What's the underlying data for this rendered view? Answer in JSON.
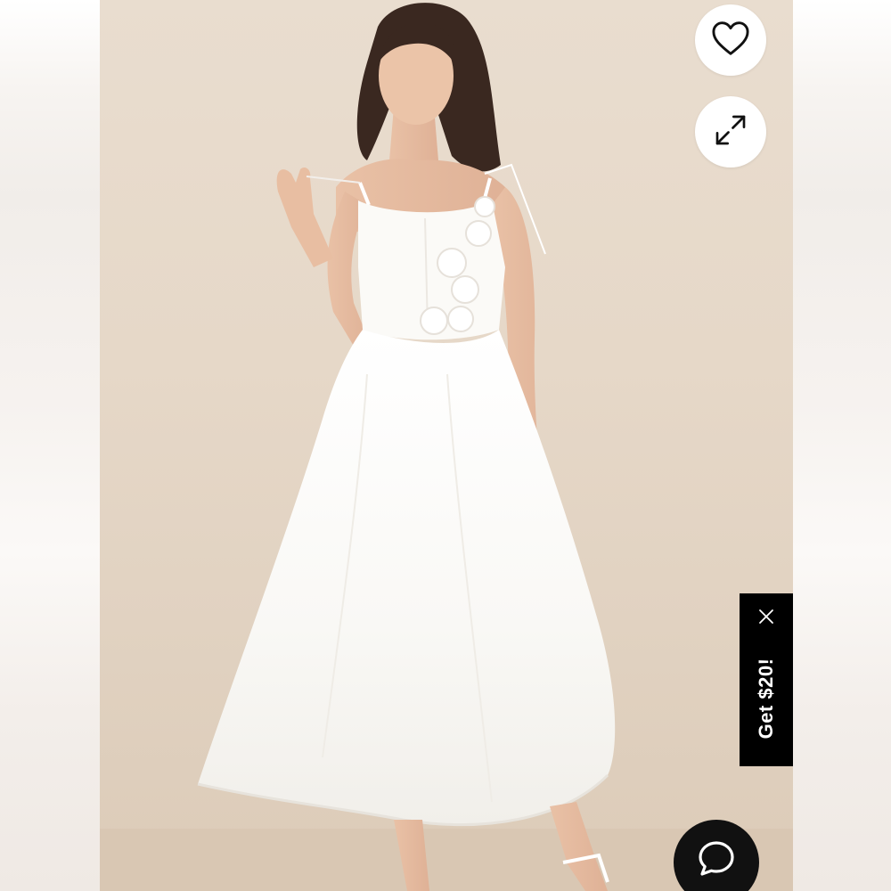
{
  "promo": {
    "label": "Get $20!"
  },
  "icons": {
    "wishlist": "heart-icon",
    "expand": "expand-arrows-icon",
    "promo_close": "close-icon",
    "chat": "chat-bubble-icon"
  },
  "colors": {
    "promo_background": "#000000",
    "promo_text": "#ffffff",
    "chat_background": "#111111",
    "photo_background": "#e6d8c8",
    "dress": "#fbfaf7"
  }
}
